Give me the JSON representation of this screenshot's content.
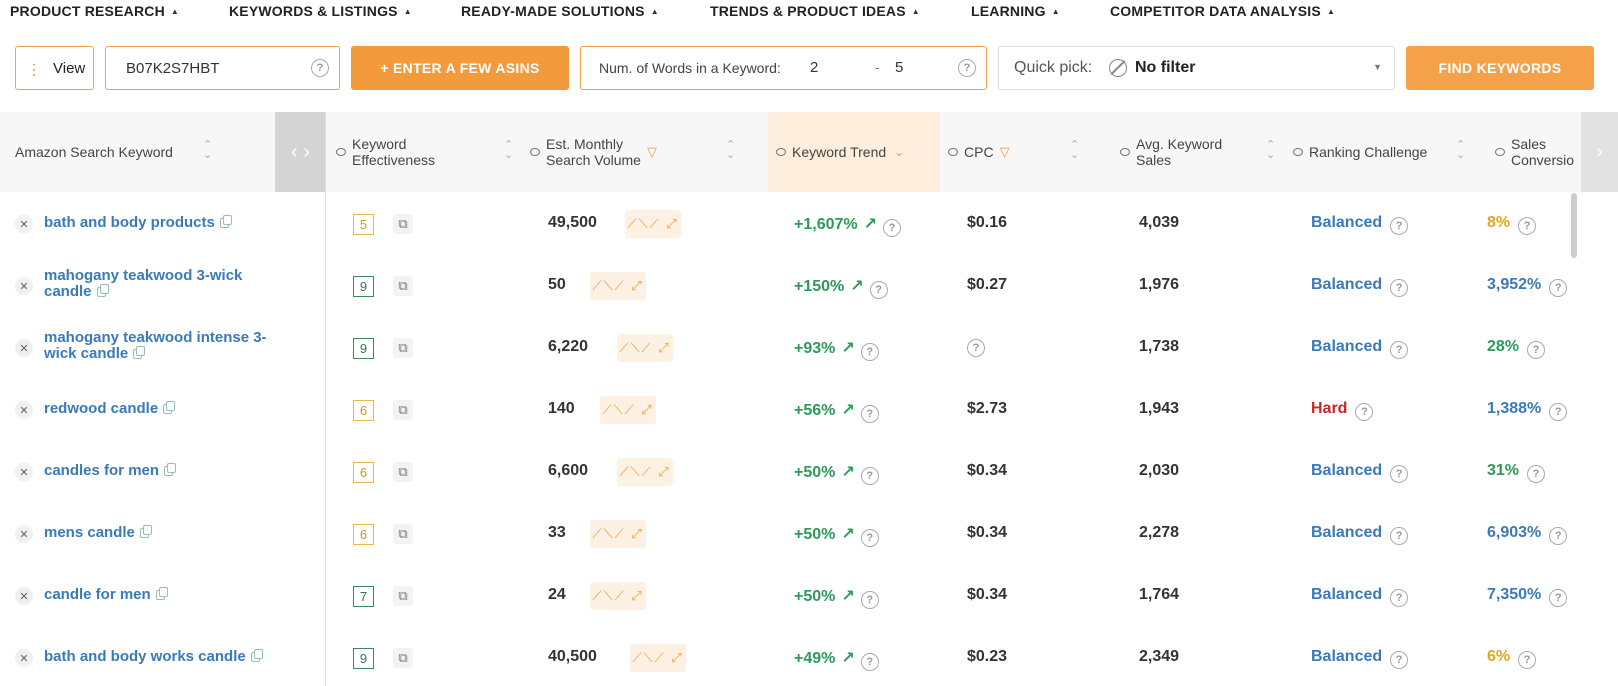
{
  "nav": [
    {
      "label": "PRODUCT RESEARCH"
    },
    {
      "label": "KEYWORDS & LISTINGS"
    },
    {
      "label": "READY-MADE SOLUTIONS"
    },
    {
      "label": "TRENDS & PRODUCT IDEAS"
    },
    {
      "label": "LEARNING"
    },
    {
      "label": "COMPETITOR DATA ANALYSIS"
    }
  ],
  "toolbar": {
    "view_label": "View",
    "asin_value": "B07K2S7HBT",
    "enter_asins_label": "+ ENTER A FEW ASINS",
    "words_label": "Num. of Words in a Keyword:",
    "words_min": "2",
    "words_dash": "-",
    "words_max": "5",
    "quick_pick_label": "Quick pick:",
    "quick_pick_value": "No filter",
    "find_label": "FIND KEYWORDS"
  },
  "columns": {
    "keyword": "Amazon Search Keyword",
    "effectiveness_1": "Keyword",
    "effectiveness_2": "Effectiveness",
    "volume_1": "Est. Monthly",
    "volume_2": "Search Volume",
    "trend": "Keyword Trend",
    "cpc": "CPC",
    "avg_sales_1": "Avg. Keyword",
    "avg_sales_2": "Sales",
    "ranking": "Ranking Challenge",
    "conversion_1": "Sales",
    "conversion_2": "Conversio"
  },
  "rows": [
    {
      "kw1": "bath and body products",
      "kw2": "",
      "eff": "5",
      "eff_color": "y",
      "vol": "49,500",
      "trend": "+1,607%",
      "cpc": "$0.16",
      "avg": "4,039",
      "rank": "Balanced",
      "rank_type": "balanced",
      "conv": "8%",
      "conv_color": "#e0a81c"
    },
    {
      "kw1": "mahogany teakwood 3-wick",
      "kw2": "candle",
      "eff": "9",
      "eff_color": "g",
      "vol": "50",
      "trend": "+150%",
      "cpc": "$0.27",
      "avg": "1,976",
      "rank": "Balanced",
      "rank_type": "balanced",
      "conv": "3,952%",
      "conv_color": "#3a7ab8"
    },
    {
      "kw1": "mahogany teakwood intense 3-",
      "kw2": "wick candle",
      "eff": "9",
      "eff_color": "g",
      "vol": "6,220",
      "trend": "+93%",
      "cpc": "",
      "avg": "1,738",
      "rank": "Balanced",
      "rank_type": "balanced",
      "conv": "28%",
      "conv_color": "#2d9a5a"
    },
    {
      "kw1": "redwood candle",
      "kw2": "",
      "eff": "6",
      "eff_color": "y",
      "vol": "140",
      "trend": "+56%",
      "cpc": "$2.73",
      "avg": "1,943",
      "rank": "Hard",
      "rank_type": "hard",
      "conv": "1,388%",
      "conv_color": "#3a7ab8"
    },
    {
      "kw1": "candles for men",
      "kw2": "",
      "eff": "6",
      "eff_color": "y",
      "vol": "6,600",
      "trend": "+50%",
      "cpc": "$0.34",
      "avg": "2,030",
      "rank": "Balanced",
      "rank_type": "balanced",
      "conv": "31%",
      "conv_color": "#2d9a5a"
    },
    {
      "kw1": "mens candle",
      "kw2": "",
      "eff": "6",
      "eff_color": "y",
      "vol": "33",
      "trend": "+50%",
      "cpc": "$0.34",
      "avg": "2,278",
      "rank": "Balanced",
      "rank_type": "balanced",
      "conv": "6,903%",
      "conv_color": "#3a7ab8"
    },
    {
      "kw1": "candle for men",
      "kw2": "",
      "eff": "7",
      "eff_color": "g",
      "vol": "24",
      "trend": "+50%",
      "cpc": "$0.34",
      "avg": "1,764",
      "rank": "Balanced",
      "rank_type": "balanced",
      "conv": "7,350%",
      "conv_color": "#3a7ab8"
    },
    {
      "kw1": "bath and body works candle",
      "kw2": "",
      "eff": "9",
      "eff_color": "g",
      "vol": "40,500",
      "trend": "+49%",
      "cpc": "$0.23",
      "avg": "2,349",
      "rank": "Balanced",
      "rank_type": "balanced",
      "conv": "6%",
      "conv_color": "#e0a81c"
    }
  ],
  "colors": {
    "accent": "#f39a3c",
    "link": "#3a7ab8",
    "positive": "#2d9a5a",
    "hard": "#c62828"
  },
  "icons": {
    "help": "?",
    "arrow_up_right": "↗",
    "external": "⧉",
    "remove": "✕",
    "sparkline": "chart-line-icon"
  }
}
